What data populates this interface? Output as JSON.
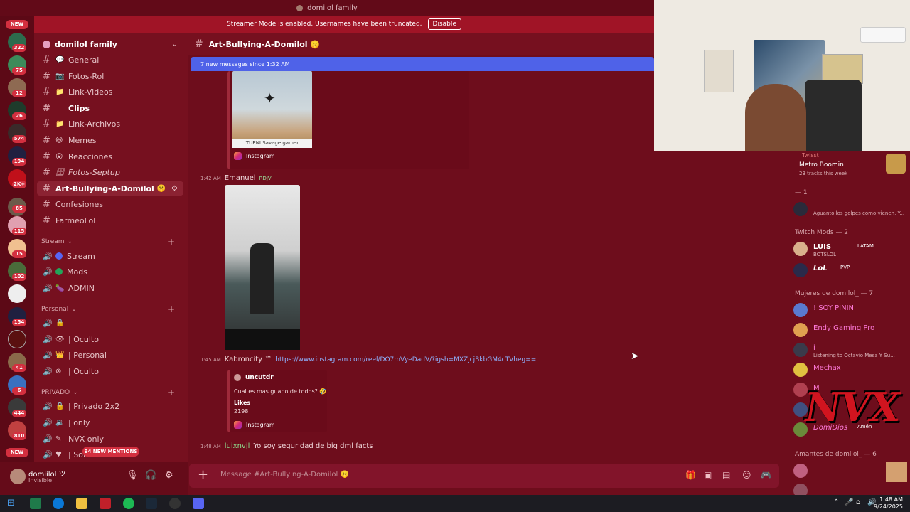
{
  "window": {
    "title": "domilol family"
  },
  "banner": {
    "text": "Streamer Mode is enabled. Usernames have been truncated.",
    "button": "Disable"
  },
  "server": {
    "name": "domilol family"
  },
  "rail": {
    "new_top": "NEW",
    "new_bottom": "NEW",
    "badges": [
      "322",
      "75",
      "12",
      "26",
      "574",
      "194",
      "2K+",
      "85",
      "115",
      "15",
      "102",
      "154",
      "41",
      "6",
      "444",
      "810"
    ],
    "colors": {
      "rail_bg": "#5c0916",
      "badge": "#d32f3f"
    }
  },
  "channels": [
    {
      "name": "General",
      "emoji": "💬"
    },
    {
      "name": "Fotos-Rol",
      "emoji": "📷"
    },
    {
      "name": "Link-Videos",
      "emoji": "📁"
    },
    {
      "name": "Clips",
      "emoji": ""
    },
    {
      "name": "Link-Archivos",
      "emoji": "📁"
    },
    {
      "name": "Memes",
      "emoji": "😆"
    },
    {
      "name": "Reacciones",
      "emoji": "😮"
    },
    {
      "name": "Fotos-Septup",
      "emoji": "🗄"
    },
    {
      "name": "Art-Bullying-A-Domilol",
      "emoji": "🤫"
    },
    {
      "name": "Confesiones",
      "emoji": ""
    },
    {
      "name": "FarmeoLol",
      "emoji": ""
    }
  ],
  "categories": {
    "stream": "Stream",
    "personal": "Personal",
    "privado": "PRIVADO"
  },
  "voice": {
    "stream": [
      "Stream",
      "Mods",
      "ADMIN"
    ],
    "personal": [
      "",
      "| Oculto",
      "| Personal",
      "| Oculto"
    ],
    "privado": [
      "| Privado 2x2",
      "| only",
      "NVX only",
      "| Sof"
    ]
  },
  "mentions": "94 NEW MENTIONS",
  "user": {
    "name": "domiilol ツ",
    "status": "Invisible"
  },
  "chat": {
    "channel": "Art-Bullying-A-Domilol 🤫",
    "new_messages": "7 new messages since 1:32 AM",
    "embed1_caption": "TUENI Savage gamer",
    "instagram": "Instagram",
    "msg1": {
      "time": "1:42 AM",
      "author": "Emanuel",
      "tag": "RDJV"
    },
    "msg2": {
      "time": "1:45 AM",
      "author": "Kabroncity ™",
      "link": "https://www.instagram.com/reel/DO7mVyeDadV/?igsh=MXZjcjBkbGM4cTVheg=="
    },
    "embed2": {
      "author": "uncutdr",
      "text": "Cual es mas guapo de todos? 🤣",
      "likes_label": "Likes",
      "likes": "2198"
    },
    "msg3": {
      "time": "1:48 AM",
      "author": "luixnvjl",
      "text": "Yo soy seguridad de big dml facts"
    },
    "composer_placeholder": "Message #Art-Bullying-A-Domilol 🤫"
  },
  "members": {
    "top": {
      "name": "Twisst",
      "activity": "Metro Boomin",
      "sub": "23 tracks this week"
    },
    "group1": "— 1",
    "group1_item": "Aguanto los golpes como vienen, Y...",
    "twitch_mods": "Twitch Mods — 2",
    "mods": [
      {
        "name": "LUIS",
        "sub": "BOTSLOL",
        "tag": "LATAM"
      },
      {
        "name": "LoL",
        "tag": "PVP"
      }
    ],
    "mujeres": "Mujeres de domilol_ — 7",
    "women": [
      {
        "name": "! SOY PININI",
        "sub": ""
      },
      {
        "name": "Endy Gaming Pro",
        "sub": ""
      },
      {
        "name": "i",
        "sub": "Listening to Octavio Mesa Y Su..."
      },
      {
        "name": "Mechax",
        "sub": ""
      },
      {
        "name": "M",
        "sub": ""
      },
      {
        "name": "",
        "sub": ""
      },
      {
        "name": "DomiDios",
        "sub": "Amén"
      }
    ],
    "amantes": "Amantes de domilol_ — 6"
  },
  "overlay": {
    "text": "NVX"
  },
  "clock": {
    "time": "1:48 AM",
    "date": "9/24/2025"
  }
}
